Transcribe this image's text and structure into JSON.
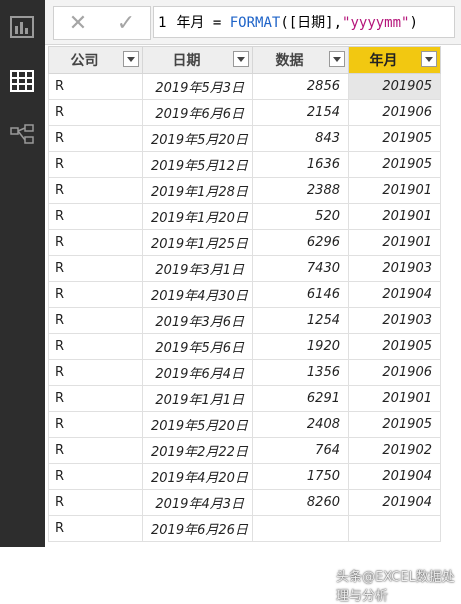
{
  "formula": {
    "line_no": "1",
    "measure": "年月 = ",
    "fn": "FORMAT",
    "args_open": "([日期],",
    "str": "\"yyyymm\"",
    "close": ")"
  },
  "table": {
    "headers": [
      "公司",
      "日期",
      "数据",
      "年月"
    ],
    "rows": [
      [
        "R",
        "2019年5月3日",
        "2856",
        "201905"
      ],
      [
        "R",
        "2019年6月6日",
        "2154",
        "201906"
      ],
      [
        "R",
        "2019年5月20日",
        "843",
        "201905"
      ],
      [
        "R",
        "2019年5月12日",
        "1636",
        "201905"
      ],
      [
        "R",
        "2019年1月28日",
        "2388",
        "201901"
      ],
      [
        "R",
        "2019年1月20日",
        "520",
        "201901"
      ],
      [
        "R",
        "2019年1月25日",
        "6296",
        "201901"
      ],
      [
        "R",
        "2019年3月1日",
        "7430",
        "201903"
      ],
      [
        "R",
        "2019年4月30日",
        "6146",
        "201904"
      ],
      [
        "R",
        "2019年3月6日",
        "1254",
        "201903"
      ],
      [
        "R",
        "2019年5月6日",
        "1920",
        "201905"
      ],
      [
        "R",
        "2019年6月4日",
        "1356",
        "201906"
      ],
      [
        "R",
        "2019年1月1日",
        "6291",
        "201901"
      ],
      [
        "R",
        "2019年5月20日",
        "2408",
        "201905"
      ],
      [
        "R",
        "2019年2月22日",
        "764",
        "201902"
      ],
      [
        "R",
        "2019年4月20日",
        "1750",
        "201904"
      ],
      [
        "R",
        "2019年4月3日",
        "8260",
        "201904"
      ],
      [
        "R",
        "2019年6月26日",
        "",
        ""
      ]
    ]
  },
  "watermark": "头条@EXCEL数据处理与分析",
  "colors": {
    "accent": "#f2c811",
    "sidebar": "#2d2d2d"
  }
}
